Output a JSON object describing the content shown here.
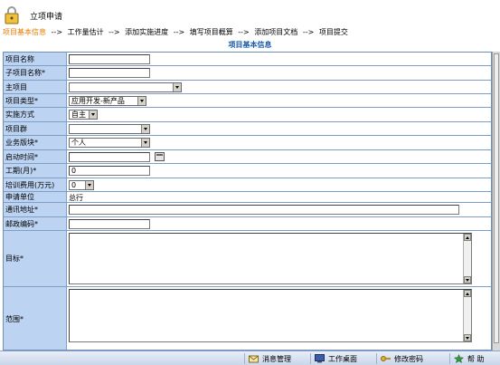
{
  "app": {
    "title": "立项申请"
  },
  "steps": [
    {
      "label": "项目基本信息",
      "current": true
    },
    {
      "label": "工作量估计",
      "current": false
    },
    {
      "label": "添加实施进度",
      "current": false
    },
    {
      "label": "填写项目概算",
      "current": false
    },
    {
      "label": "添加项目文档",
      "current": false
    },
    {
      "label": "项目提交",
      "current": false
    }
  ],
  "steps_separator": "-->",
  "section": {
    "title": "项目基本信息"
  },
  "form": {
    "project_name": {
      "label": "项目名称",
      "value": ""
    },
    "sub_project_name": {
      "label": "子项目名称*",
      "value": ""
    },
    "main_project": {
      "label": "主项目",
      "value": ""
    },
    "project_type": {
      "label": "项目类型*",
      "value": "应用开发-新产品"
    },
    "impl_method": {
      "label": "实施方式",
      "value": "自主"
    },
    "project_group": {
      "label": "项目群",
      "value": ""
    },
    "business_block": {
      "label": "业务版块*",
      "value": "个人"
    },
    "start_time": {
      "label": "启动时间*",
      "value": ""
    },
    "duration": {
      "label": "工期(月)*",
      "value": "0"
    },
    "training_fee": {
      "label": "培训费用(万元)",
      "value": "0"
    },
    "applicant_unit": {
      "label": "申请单位",
      "value": "总行"
    },
    "address": {
      "label": "通讯地址*",
      "value": ""
    },
    "postcode": {
      "label": "邮政编码*",
      "value": ""
    },
    "goal": {
      "label": "目标*",
      "value": ""
    },
    "scope": {
      "label": "范围*",
      "value": ""
    }
  },
  "taskbar": {
    "message_mgmt": "消息管理",
    "work_desktop": "工作桌面",
    "change_password": "修改密码",
    "help": "帮 助"
  },
  "colors": {
    "label_bg": "#bcd3f2",
    "border": "#7f9ec6",
    "current_step": "#e87b00",
    "section_title": "#1a5aa8"
  }
}
